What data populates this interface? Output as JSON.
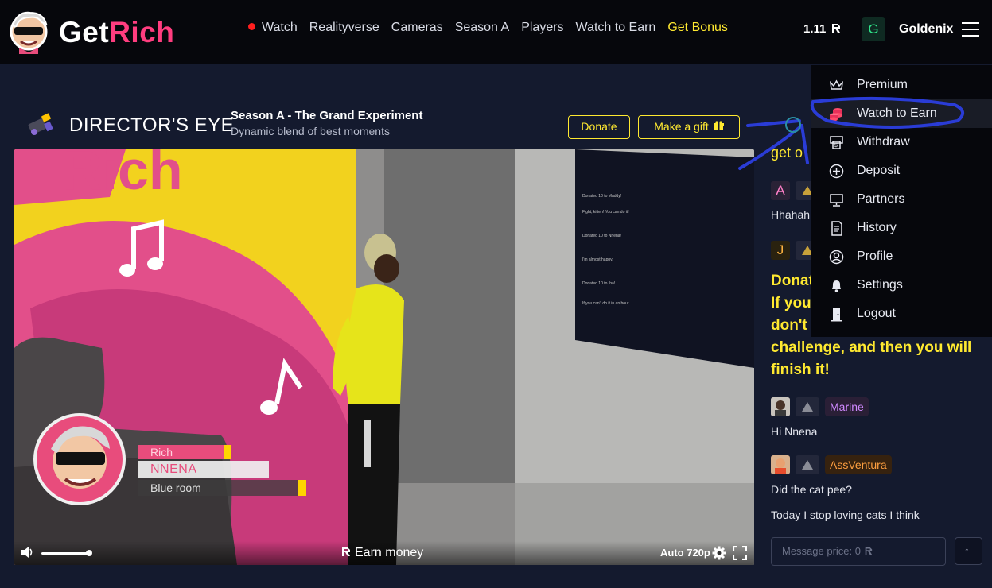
{
  "brand": {
    "part1": "Get",
    "part2": "Rich"
  },
  "nav": {
    "items": [
      "Watch",
      "Realityverse",
      "Cameras",
      "Season A",
      "Players",
      "Watch to Earn"
    ],
    "bonus": "Get Bonus"
  },
  "account": {
    "balance": "1.11",
    "avatar_letter": "G",
    "username": "Goldenix"
  },
  "channel": {
    "title": "DIRECTOR'S EYE",
    "season": "Season A - The Grand Experiment",
    "subtitle": "Dynamic blend of best moments",
    "donate_label": "Donate",
    "gift_label": "Make a gift"
  },
  "video": {
    "lower_third": {
      "top": "Rich",
      "name": "NNENA",
      "room": "Blue room"
    },
    "earn_label": "Earn money",
    "quality": "Auto 720p",
    "volume_level": 0.85
  },
  "menu": {
    "items": [
      {
        "label": "Premium",
        "icon": "crown-icon"
      },
      {
        "label": "Watch to Earn",
        "icon": "coins-icon"
      },
      {
        "label": "Withdraw",
        "icon": "atm-icon"
      },
      {
        "label": "Deposit",
        "icon": "plus-circle-icon"
      },
      {
        "label": "Partners",
        "icon": "monitor-icon"
      },
      {
        "label": "History",
        "icon": "receipt-icon"
      },
      {
        "label": "Profile",
        "icon": "user-circle-icon"
      },
      {
        "label": "Settings",
        "icon": "bell-icon"
      },
      {
        "label": "Logout",
        "icon": "door-icon"
      }
    ],
    "highlighted": "Watch to Earn"
  },
  "chat": {
    "partial_heading": "get o",
    "badge_a": "A",
    "msg1": "Hhahah",
    "badge_j": "J",
    "big_message_lines": [
      "Donat",
      "If you",
      "don't",
      "challenge, and then you will",
      "finish it!"
    ],
    "user1": {
      "name": "Marine",
      "message": "Hi Nnena"
    },
    "user2": {
      "name": "AssVentura",
      "message": "Did the cat pee?"
    },
    "msg_last": "Today I stop loving cats I think",
    "input_placeholder": "Message price: 0"
  },
  "colors": {
    "accent_yellow": "#ffe930",
    "brand_pink": "#ff3d7f",
    "background": "#141a2e",
    "menu_bg": "#06070c"
  }
}
